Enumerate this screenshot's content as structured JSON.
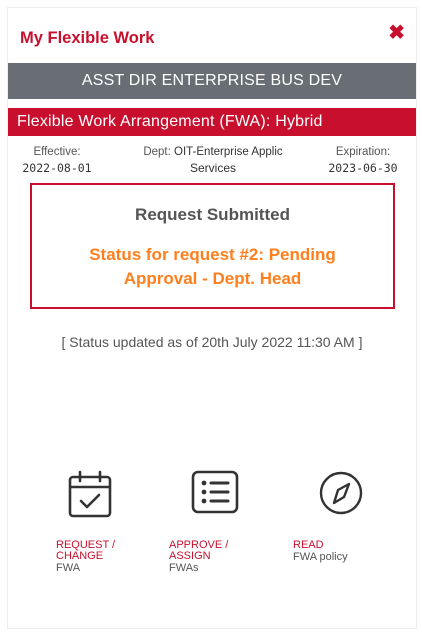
{
  "header": {
    "title": "My Flexible Work",
    "close_glyph": "✖"
  },
  "banner": {
    "position_title": "ASST DIR ENTERPRISE BUS DEV"
  },
  "fwa": {
    "label": "Flexible Work Arrangement (FWA): Hybrid"
  },
  "details": {
    "effective_label": "Effective:",
    "effective_value": "2022-08-01",
    "dept_label": "Dept:",
    "dept_value_line1": "OIT-Enterprise Applic",
    "dept_value_line2": "Services",
    "expiration_label": "Expiration:",
    "expiration_value": "2023-06-30"
  },
  "status": {
    "heading": "Request Submitted",
    "message": "Status for request #2: Pending Approval - Dept. Head",
    "updated": "[ Status updated as of 20th July 2022 11:30 AM ]"
  },
  "actions": [
    {
      "icon": "calendar-check-icon",
      "label": "REQUEST / CHANGE",
      "sublabel": "FWA"
    },
    {
      "icon": "list-icon",
      "label": "APPROVE / ASSIGN",
      "sublabel": "FWAs"
    },
    {
      "icon": "compass-icon",
      "label": "READ",
      "sublabel": "FWA policy"
    }
  ],
  "colors": {
    "accent_red": "#c8102e",
    "banner_gray": "#686e73",
    "status_orange": "#ff7f1e"
  }
}
